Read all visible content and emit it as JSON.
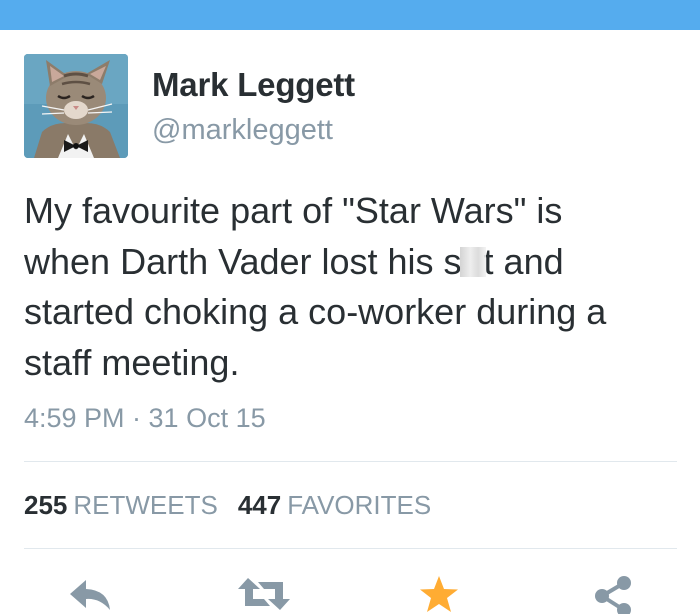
{
  "header": {
    "bar_color": "#55acee"
  },
  "user": {
    "display_name": "Mark Leggett",
    "handle": "@markleggett",
    "avatar_description": "cat-avatar"
  },
  "tweet": {
    "line1": "My favourite part of \"Star Wars\" is",
    "line2_before": "when Darth Vader lost his s",
    "line2_after": "t and",
    "line3": "started choking a co-worker during a",
    "line4": "staff meeting.",
    "timestamp": "4:59 PM · 31 Oct 15"
  },
  "stats": {
    "retweets_count": "255",
    "retweets_label": "RETWEETS",
    "favorites_count": "447",
    "favorites_label": "FAVORITES"
  },
  "actions": {
    "reply_icon": "reply-icon",
    "retweet_icon": "retweet-icon",
    "favorite_icon": "star-icon",
    "share_icon": "share-icon"
  },
  "colors": {
    "text": "#292f33",
    "muted": "#8899a6",
    "accent": "#55acee",
    "favorite": "#ffac33",
    "divider": "#e1e8ed"
  }
}
